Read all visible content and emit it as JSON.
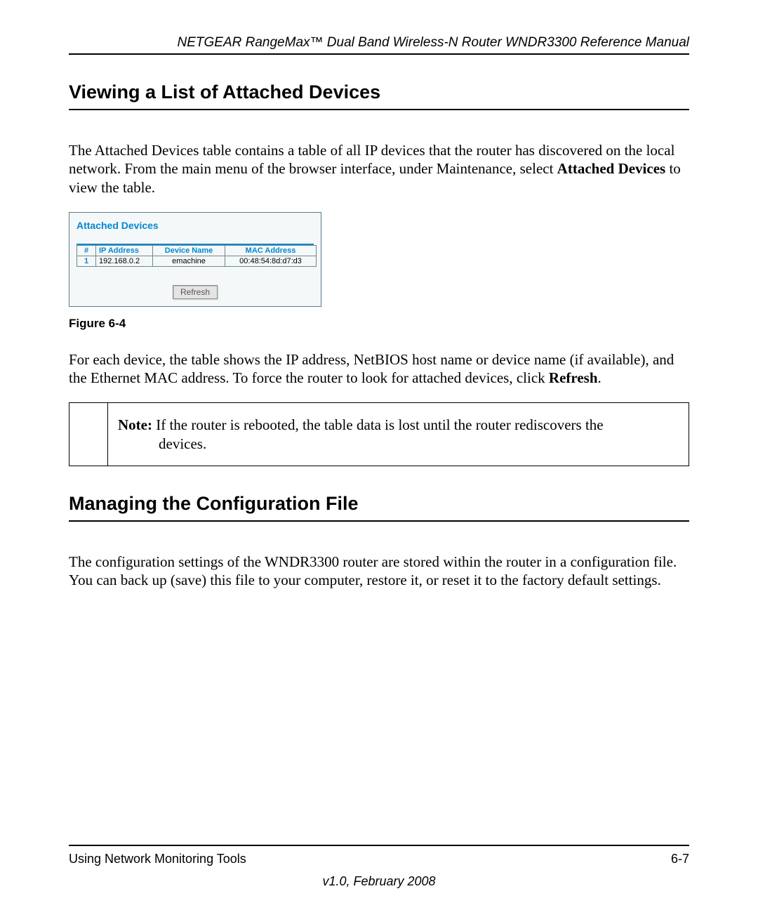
{
  "header": {
    "running_title": "NETGEAR RangeMax™ Dual Band Wireless-N Router WNDR3300 Reference Manual"
  },
  "sections": {
    "s1": {
      "heading": "Viewing a List of Attached Devices",
      "para1_pre": "The Attached Devices table contains a table of all IP devices that the router has discovered on the local network. From the main menu of the browser interface, under Maintenance, select ",
      "para1_bold": "Attached Devices",
      "para1_post": " to view the table.",
      "para2_pre": "For each device, the table shows the IP address, NetBIOS host name or device name (if available), and the Ethernet MAC address. To force the router to look for attached devices, click ",
      "para2_bold": "Refresh",
      "para2_post": "."
    },
    "s2": {
      "heading": "Managing the Configuration File",
      "para1": "The configuration settings of the WNDR3300 router are stored within the router in a configuration file. You can back up (save) this file to your computer, restore it, or reset it to the factory default settings."
    }
  },
  "figure": {
    "panel_title": "Attached Devices",
    "columns": {
      "c0": "#",
      "c1": "IP Address",
      "c2": "Device Name",
      "c3": "MAC Address"
    },
    "rows": [
      {
        "idx": "1",
        "ip": "192.168.0.2",
        "name": "emachine",
        "mac": "00:48:54:8d:d7:d3"
      }
    ],
    "refresh_label": "Refresh",
    "caption": "Figure 6-4"
  },
  "note": {
    "label": "Note:",
    "line1": " If the router is rebooted, the table data is lost until the router rediscovers the",
    "line2": "devices."
  },
  "footer": {
    "left": "Using Network Monitoring Tools",
    "right": "6-7",
    "version": "v1.0, February 2008"
  }
}
